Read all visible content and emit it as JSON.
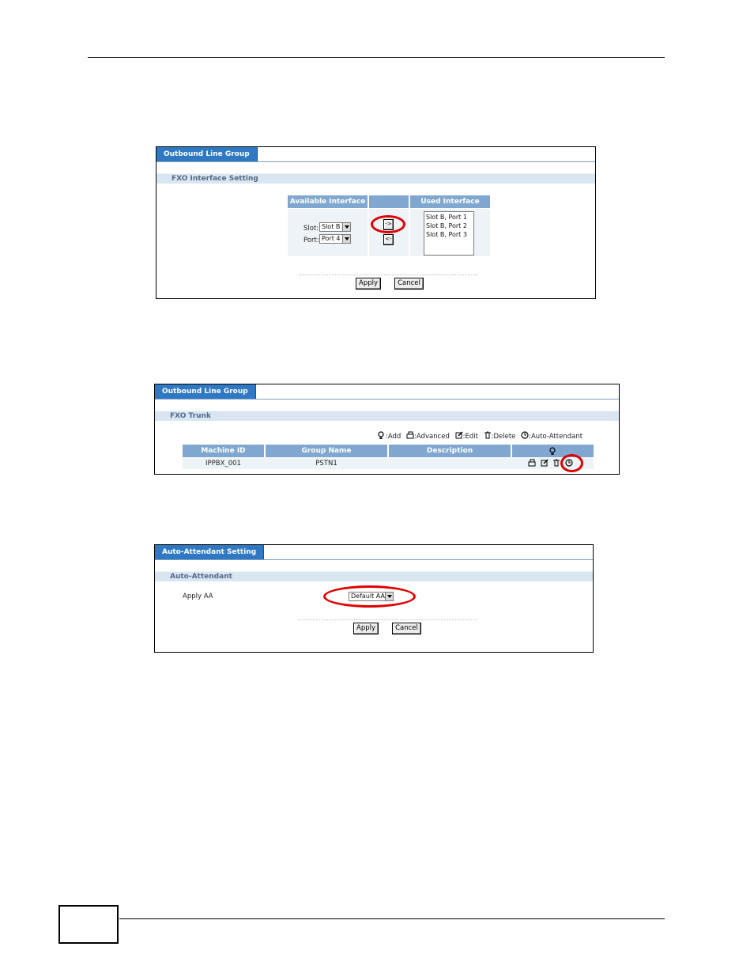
{
  "panel1": {
    "tab_label": "Outbound Line Group",
    "section_label": "FXO Interface Setting",
    "headers": {
      "available": "Available Interface",
      "middle": "",
      "used": "Used Interface"
    },
    "slot_label": "Slot:",
    "slot_value": "Slot B",
    "port_label": "Port:",
    "port_value": "Port 4",
    "add_arrow": "->",
    "remove_arrow": "<-",
    "used_interfaces": [
      "Slot B, Port 1",
      "Slot B, Port 2",
      "Slot B, Port 3"
    ],
    "apply_label": "Apply",
    "cancel_label": "Cancel"
  },
  "panel2": {
    "tab_label": "Outbound Line Group",
    "section_label": "FXO Trunk",
    "legend": {
      "add": ":Add",
      "advanced": ":Advanced",
      "edit": ":Edit",
      "delete": ":Delete",
      "auto_attendant": ":Auto-Attendant"
    },
    "columns": [
      "Machine ID",
      "Group Name",
      "Description"
    ],
    "rows": [
      {
        "machine_id": "IPPBX_001",
        "group_name": "PSTN1",
        "description": ""
      }
    ]
  },
  "panel3": {
    "tab_label": "Auto-Attendant Setting",
    "section_label": "Auto-Attendant",
    "apply_aa_label": "Apply AA",
    "apply_aa_value": "Default AA",
    "apply_label": "Apply",
    "cancel_label": "Cancel"
  },
  "colors": {
    "tab_blue": "#2f79c4",
    "header_blue": "#7fa7cf",
    "section_bg": "#d9e6f2",
    "highlight_red": "#e00000"
  }
}
